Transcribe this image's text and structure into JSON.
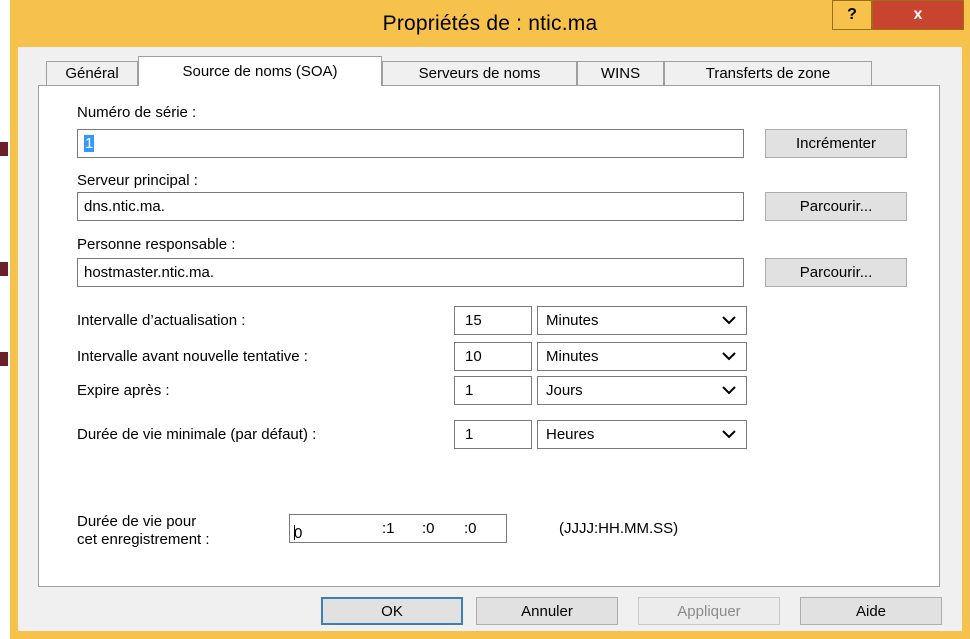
{
  "window": {
    "title": "Propriétés de : ntic.ma",
    "help_label": "?",
    "close_label": "x"
  },
  "tabs": [
    {
      "label": "Général"
    },
    {
      "label": "Source de noms (SOA)"
    },
    {
      "label": "Serveurs de noms"
    },
    {
      "label": "WINS"
    },
    {
      "label": "Transferts de zone"
    }
  ],
  "soa": {
    "serial_label": "Numéro de série :",
    "serial_value": "1",
    "increment_button": "Incrémenter",
    "primary_label": "Serveur principal :",
    "primary_value": "dns.ntic.ma.",
    "browse_button": "Parcourir...",
    "responsible_label": "Personne responsable :",
    "responsible_value": "hostmaster.ntic.ma.",
    "intervals": [
      {
        "label": "Intervalle d’actualisation :",
        "value": "15",
        "unit": "Minutes"
      },
      {
        "label": "Intervalle avant nouvelle tentative :",
        "value": "10",
        "unit": "Minutes"
      },
      {
        "label": "Expire après :",
        "value": "1",
        "unit": "Jours"
      },
      {
        "label": "Durée de vie minimale (par défaut) :",
        "value": "1",
        "unit": "Heures"
      }
    ],
    "ttl_label_line1": "Durée de vie pour",
    "ttl_label_line2": "cet enregistrement :",
    "ttl_parts": [
      "0",
      ":1",
      ":0",
      ":0"
    ],
    "ttl_format": "(JJJJ:HH.MM.SS)"
  },
  "footer": {
    "ok": "OK",
    "cancel": "Annuler",
    "apply": "Appliquer",
    "help": "Aide"
  },
  "colors": {
    "title_bar": "#f6c24c",
    "close_button": "#c9442f",
    "selection": "#3399ff"
  }
}
